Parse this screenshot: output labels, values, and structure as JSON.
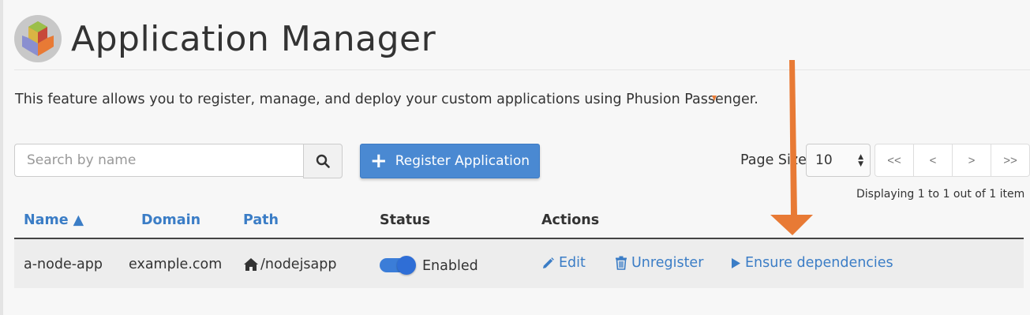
{
  "header": {
    "title": "Application Manager"
  },
  "description": "This feature allows you to register, manage, and deploy your custom applications using Phusion Passenger.",
  "toolbar": {
    "search_placeholder": "Search by name",
    "register_label": "Register Application",
    "register_plus": "+",
    "page_size_label": "Page Size",
    "page_size_value": "10",
    "pager": [
      "<<",
      "<",
      ">",
      ">>"
    ],
    "displaying": "Displaying 1 to 1 out of 1 item"
  },
  "table": {
    "headers": {
      "name": "Name ▲",
      "domain": "Domain",
      "path": "Path",
      "status": "Status",
      "actions": "Actions"
    },
    "rows": [
      {
        "name": "a-node-app",
        "domain": "example.com",
        "path": "/nodejsapp",
        "status": "Enabled",
        "enabled": true,
        "actions": {
          "edit": "Edit",
          "unregister": "Unregister",
          "ensure": "Ensure dependencies"
        }
      }
    ]
  },
  "colors": {
    "accent": "#4a89d2",
    "link": "#3b7dc6",
    "annotation_arrow": "#e87a35"
  },
  "icons": [
    "app-manager-logo",
    "search-icon",
    "plus-icon",
    "home-icon",
    "pencil-icon",
    "trash-icon",
    "play-icon",
    "down-arrow-annotation"
  ]
}
